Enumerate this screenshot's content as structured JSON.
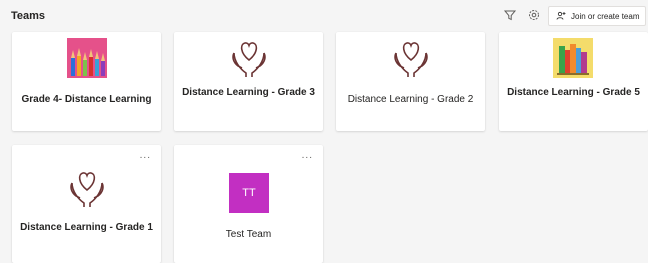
{
  "header": {
    "title": "Teams",
    "join_label": "Join or create team"
  },
  "teams": [
    {
      "name": "Grade 4- Distance Learning",
      "icon": "pencils-icon"
    },
    {
      "name": "Distance Learning - Grade 3",
      "icon": "heart-hands-icon"
    },
    {
      "name": "Distance Learning - Grade 2",
      "icon": "heart-hands-icon"
    },
    {
      "name": "Distance Learning - Grade 5",
      "icon": "books-icon"
    },
    {
      "name": "Distance Learning - Grade 1",
      "icon": "heart-hands-icon",
      "more": "..."
    },
    {
      "name": "Test Team",
      "avatar_initials": "TT",
      "avatar_color": "#c22fc2",
      "more": "..."
    }
  ],
  "colors": {
    "background": "#f5f5f5",
    "card": "#ffffff",
    "heart_icon": "#6b3434"
  }
}
